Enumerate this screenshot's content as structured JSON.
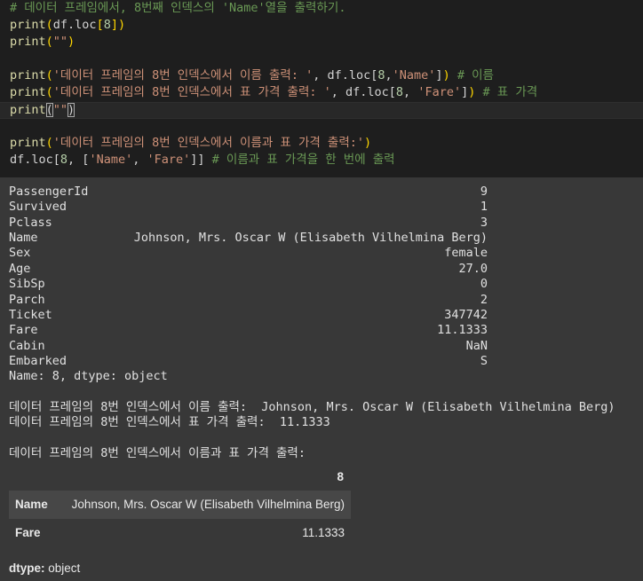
{
  "code": {
    "comment1": "# 데이터 프레임에서, 8번째 인덱스의 'Name'열을 출력하기.",
    "print_kw": "print",
    "df_loc": "df.loc",
    "line1_arg": "8",
    "line2_arg": "\"\"",
    "line4_str": "'데이터 프레임의 8번 인덱스에서 이름 출력: '",
    "line4_mid": ", df.loc[",
    "line4_idx": "8",
    "line4_sep": ",",
    "line4_col": "'Name'",
    "line4_close": "]",
    "line4_comment": "# 이름",
    "line5_str": "'데이터 프레임의 8번 인덱스에서 표 가격 출력: '",
    "line5_mid": ", df.loc[",
    "line5_idx": "8",
    "line5_sep": ", ",
    "line5_col": "'Fare'",
    "line5_close": "]",
    "line5_comment": "# 표 가격",
    "line6_arg": "\"\"",
    "line8_str": "'데이터 프레임의 8번 인덱스에서 이름과 표 가격 출력:'",
    "line9_prefix": "df.loc[",
    "line9_idx": "8",
    "line9_sep": ", [",
    "line9_col1": "'Name'",
    "line9_comma": ", ",
    "line9_col2": "'Fare'",
    "line9_close": "]]",
    "line9_comment": "# 이름과 표 가격을 한 번에 출력"
  },
  "series_output": {
    "rows": [
      {
        "key": "PassengerId",
        "value": "9"
      },
      {
        "key": "Survived",
        "value": "1"
      },
      {
        "key": "Pclass",
        "value": "3"
      },
      {
        "key": "Name",
        "value": "Johnson, Mrs. Oscar W (Elisabeth Vilhelmina Berg)"
      },
      {
        "key": "Sex",
        "value": "female"
      },
      {
        "key": "Age",
        "value": "27.0"
      },
      {
        "key": "SibSp",
        "value": "0"
      },
      {
        "key": "Parch",
        "value": "2"
      },
      {
        "key": "Ticket",
        "value": "347742"
      },
      {
        "key": "Fare",
        "value": "11.1333"
      },
      {
        "key": "Cabin",
        "value": "NaN"
      },
      {
        "key": "Embarked",
        "value": "S"
      }
    ],
    "footer": "Name: 8, dtype: object"
  },
  "print_output": {
    "name_line": "데이터 프레임의 8번 인덱스에서 이름 출력:  Johnson, Mrs. Oscar W (Elisabeth Vilhelmina Berg)",
    "fare_line": "데이터 프레임의 8번 인덱스에서 표 가격 출력:  11.1333",
    "both_line": "데이터 프레임의 8번 인덱스에서 이름과 표 가격 출력:"
  },
  "dataframe": {
    "header": "8",
    "rows": [
      {
        "key": "Name",
        "value": "Johnson, Mrs. Oscar W (Elisabeth Vilhelmina Berg)"
      },
      {
        "key": "Fare",
        "value": "11.1333"
      }
    ],
    "dtype_label": "dtype:",
    "dtype_value": " object"
  }
}
